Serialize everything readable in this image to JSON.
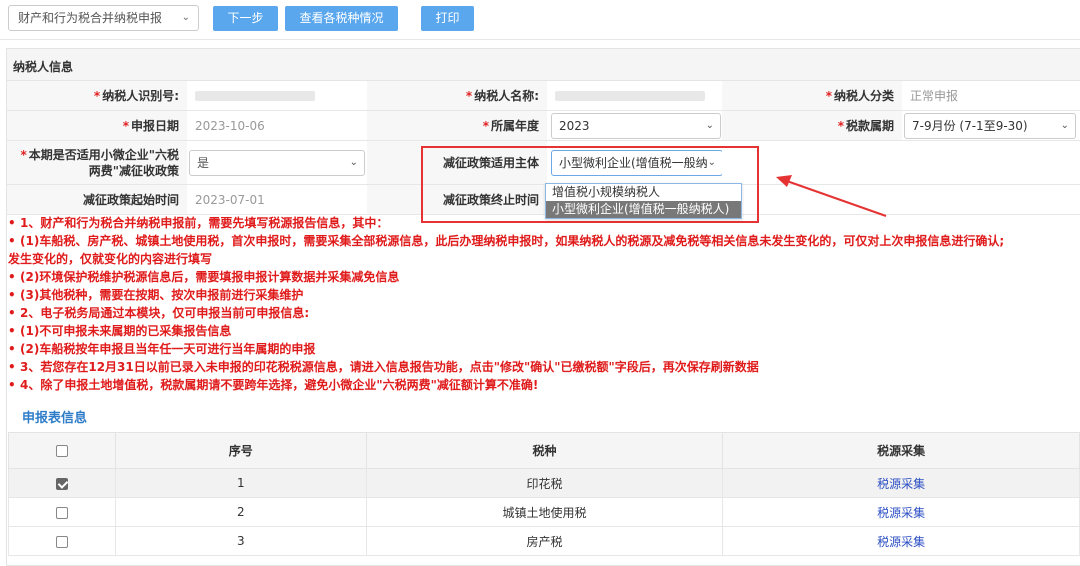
{
  "toolbar": {
    "declaration_select": "财产和行为税合并纳税申报",
    "btn_next": "下一步",
    "btn_view": "查看各税种情况",
    "btn_print": "打印"
  },
  "taxpayer": {
    "section_title": "纳税人信息",
    "id_label": "纳税人识别号:",
    "name_label": "纳税人名称:",
    "category_label": "纳税人分类",
    "category_value": "正常申报",
    "date_label": "申报日期",
    "date_value": "2023-10-06",
    "year_label": "所属年度",
    "year_value": "2023",
    "period_label": "税款属期",
    "period_value": "7-9月份 (7-1至9-30)",
    "policy_q_label": "本期是否适用小微企业\"六税两费\"减征收政策",
    "policy_q_value": "是",
    "policy_subject_label": "减征政策适用主体",
    "policy_subject_value": "小型微利企业(增值税一般纳",
    "start_label": "减征政策起始时间",
    "start_value": "2023-07-01",
    "end_label": "减征政策终止时间"
  },
  "dropdown_options": [
    "增值税小规模纳税人",
    "小型微利企业(增值税一般纳税人)"
  ],
  "notice": [
    {
      "bullet": "•",
      "text": "1、财产和行为税合并纳税申报前，需要先填写税源报告信息，其中："
    },
    {
      "bullet": "•",
      "text": "(1)车船税、房产税、城镇土地使用税，首次申报时，需要采集全部税源信息，此后办理纳税申报时，如果纳税人的税源及减免税等相关信息未发生变化的，可仅对上次申报信息进行确认;"
    },
    {
      "bullet": "",
      "text": "发生变化的，仅就变化的内容进行填写"
    },
    {
      "bullet": "•",
      "text": "(2)环境保护税维护税源信息后，需要填报申报计算数据并采集减免信息"
    },
    {
      "bullet": "•",
      "text": "(3)其他税种，需要在按期、按次申报前进行采集维护"
    },
    {
      "bullet": "•",
      "text": "2、电子税务局通过本模块，仅可申报当前可申报信息:"
    },
    {
      "bullet": "•",
      "text": "(1)不可申报未来属期的已采集报告信息"
    },
    {
      "bullet": "•",
      "text": "(2)车船税按年申报且当年任一天可进行当年属期的申报"
    },
    {
      "bullet": "•",
      "text": "3、若您存在12月31日以前已录入未申报的印花税税源信息，请进入信息报告功能，点击\"修改\"确认\"已缴税额\"字段后，再次保存刷新数据"
    },
    {
      "bullet": "•",
      "text": "4、除了申报土地增值税，税款属期请不要跨年选择，避免小微企业\"六税两费\"减征额计算不准确!"
    }
  ],
  "table": {
    "title": "申报表信息",
    "headers": [
      "序号",
      "税种",
      "税源采集"
    ],
    "rows": [
      {
        "checked": true,
        "no": "1",
        "tax": "印花税",
        "action": "税源采集"
      },
      {
        "checked": false,
        "no": "2",
        "tax": "城镇土地使用税",
        "action": "税源采集"
      },
      {
        "checked": false,
        "no": "3",
        "tax": "房产税",
        "action": "税源采集"
      }
    ]
  },
  "colors": {
    "button": "#5aa7ee",
    "notice_red": "#e01b1b",
    "highlight_box": "#e53333",
    "link": "#2c4fc4",
    "table_title": "#2f7dc8"
  }
}
